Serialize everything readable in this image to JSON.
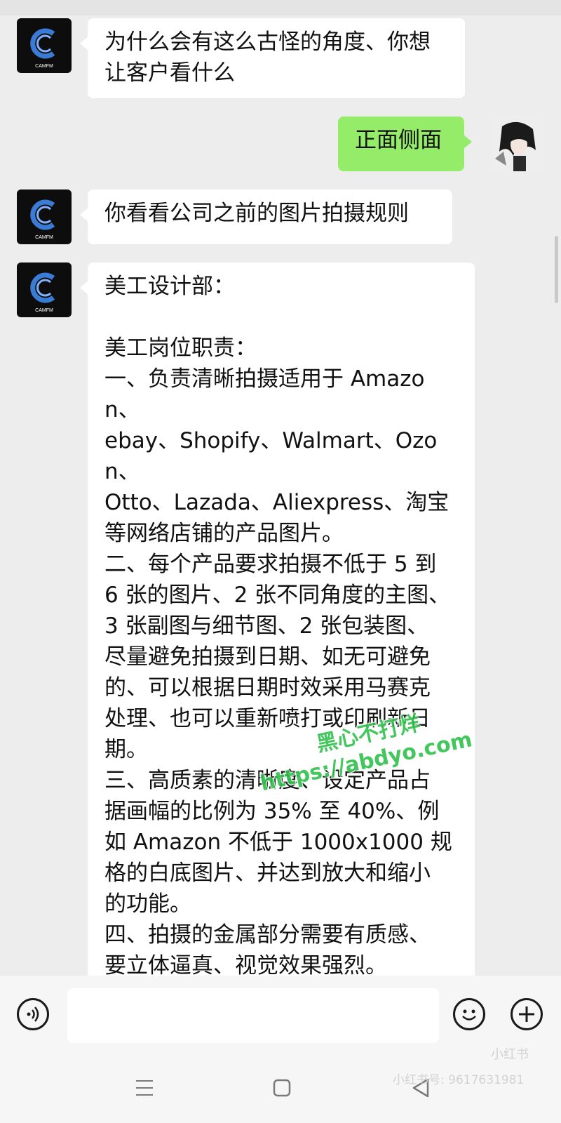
{
  "messages": [
    {
      "side": "left",
      "sender_avatar": "CAMFM",
      "text": "为什么会有这么古怪的角度、你想\n让客户看什么"
    },
    {
      "side": "right",
      "sender_avatar": "anime-avatar",
      "text": "正面侧面"
    },
    {
      "side": "left",
      "sender_avatar": "CAMFM",
      "text": "你看看公司之前的图片拍摄规则"
    },
    {
      "side": "left",
      "sender_avatar": "CAMFM",
      "text": "美工设计部：\n\n美工岗位职责：\n一、负责清晰拍摄适用于 Amazon、\nebay、Shopify、Walmart、Ozon、\nOtto、Lazada、Aliexpress、淘宝\n等网络店铺的产品图片。\n二、每个产品要求拍摄不低于 5 到\n6 张的图片、2 张不同角度的主图、\n3 张副图与细节图、2 张包装图、\n尽量避免拍摄到日期、如无可避免\n的、可以根据日期时效采用马赛克\n处理、也可以重新喷打或印刷新日\n期。\n三、高质素的清晰度、设定产品占\n据画幅的比例为 35% 至 40%、例\n如 Amazon 不低于 1000x1000 规\n格的白底图片、并达到放大和缩小\n的功能。\n四、拍摄的金属部分需要有质感、\n要立体逼真、视觉效果强烈。\n五、所有产品必须彻底清洁干净才\n能拍摄、有污渍和破损的地方、需"
    }
  ],
  "watermark": {
    "line1": "黑心不打烊",
    "line2": "https://abdyo.com"
  },
  "corner_watermark": {
    "line1": "小红书",
    "line2": "小红书号: 9617631981"
  },
  "icons": {
    "voice": "voice-icon",
    "emoji": "emoji-icon",
    "plus": "plus-icon",
    "menu": "menu-icon",
    "home": "home-icon",
    "back": "back-icon"
  },
  "colors": {
    "background": "#ededed",
    "sent_bubble": "#95ec69",
    "received_bubble": "#ffffff",
    "watermark": "#2fc24c"
  }
}
